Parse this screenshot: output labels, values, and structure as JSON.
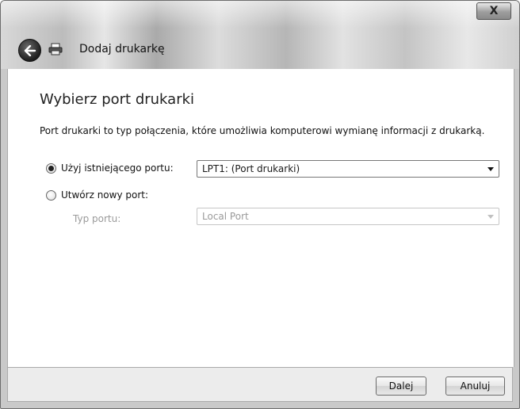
{
  "window": {
    "close_glyph": "X"
  },
  "nav": {
    "title": "Dodaj drukarkę"
  },
  "main": {
    "heading": "Wybierz port drukarki",
    "description": "Port drukarki to typ połączenia, które umożliwia komputerowi wymianę informacji z drukarką.",
    "existing_port": {
      "label": "Użyj istniejącego portu:",
      "selected": true,
      "combo_value": "LPT1: (Port drukarki)"
    },
    "new_port": {
      "label": "Utwórz nowy port:",
      "selected": false,
      "type_label": "Typ portu:",
      "type_value": "Local Port",
      "enabled": false
    }
  },
  "footer": {
    "next_label": "Dalej",
    "cancel_label": "Anuluj"
  }
}
